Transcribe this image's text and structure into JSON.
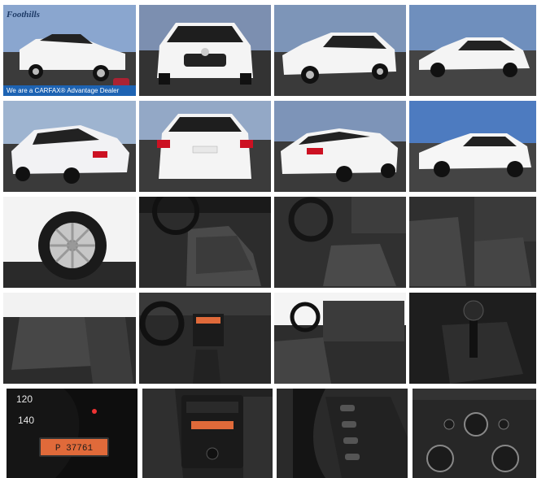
{
  "dealer": {
    "logo_text": "Foothills",
    "banner_text": "We are a CARFAX® Advantage Dealer",
    "carfax_badge": "CARFAX"
  },
  "gauge": {
    "speed_120": "120",
    "speed_140": "140",
    "gear": "P",
    "odometer": "37761"
  },
  "colors": {
    "car_body": "#f4f4f4",
    "sky": "#5a7fb8",
    "asphalt": "#3a3a3a",
    "interior": "#2b2b2b",
    "display_orange": "#e06a3a"
  },
  "tiles": [
    {
      "id": 1,
      "subject": "front-three-quarter-view"
    },
    {
      "id": 2,
      "subject": "front-view"
    },
    {
      "id": 3,
      "subject": "front-left-view"
    },
    {
      "id": 4,
      "subject": "side-view-left"
    },
    {
      "id": 5,
      "subject": "rear-three-quarter-view"
    },
    {
      "id": 6,
      "subject": "rear-view"
    },
    {
      "id": 7,
      "subject": "rear-right-view"
    },
    {
      "id": 8,
      "subject": "side-view-right"
    },
    {
      "id": 9,
      "subject": "wheel-closeup"
    },
    {
      "id": 10,
      "subject": "front-seats"
    },
    {
      "id": 11,
      "subject": "dashboard-driver-side"
    },
    {
      "id": 12,
      "subject": "front-seats-passenger-side"
    },
    {
      "id": 13,
      "subject": "rear-seats"
    },
    {
      "id": 14,
      "subject": "center-dash"
    },
    {
      "id": 15,
      "subject": "interior-passenger-view"
    },
    {
      "id": 16,
      "subject": "gear-shifter"
    },
    {
      "id": 17,
      "subject": "instrument-cluster"
    },
    {
      "id": 18,
      "subject": "radio-console"
    },
    {
      "id": 19,
      "subject": "steering-wheel-controls"
    },
    {
      "id": 20,
      "subject": "climate-controls"
    }
  ]
}
